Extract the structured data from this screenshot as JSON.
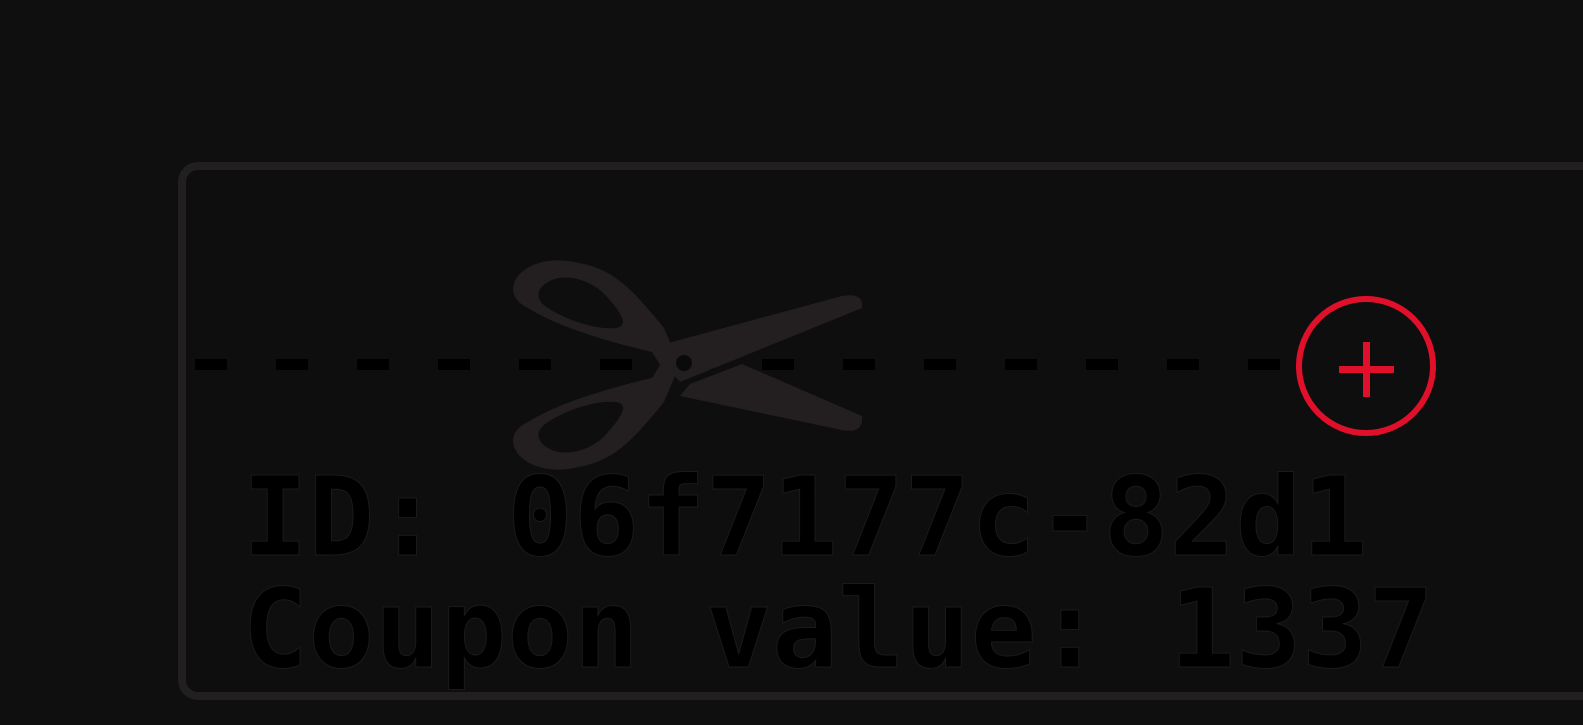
{
  "coupon": {
    "id_text": "ID: 06f7177c-82d1",
    "value_text": "Coupon value: 1337"
  },
  "icons": {
    "cut": "scissors-icon",
    "add": "plus-icon"
  },
  "colors": {
    "background": "#0f0f10",
    "card_border": "#221f20",
    "scissors": "#231f20",
    "accent": "#e0102a",
    "text": "#000000"
  }
}
